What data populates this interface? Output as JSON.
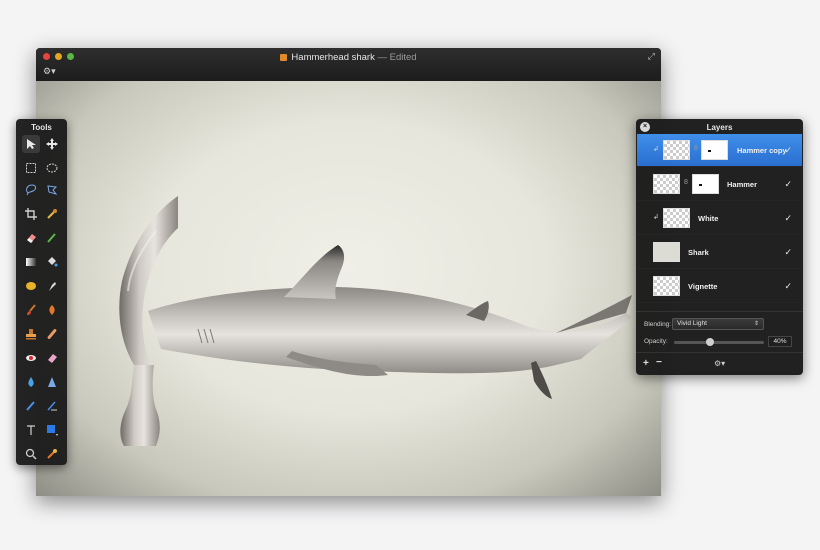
{
  "window": {
    "title": "Hammerhead shark",
    "status": "— Edited",
    "gear_glyph": "⚙▾",
    "fullscreen_glyph": "⤢"
  },
  "tools": {
    "title": "Tools",
    "items": [
      "arrow-select-icon",
      "move-icon",
      "rect-select-icon",
      "ellipse-select-icon",
      "lasso-icon",
      "polygon-lasso-icon",
      "crop-icon",
      "eyedropper-icon",
      "eraser-icon",
      "pencil-icon",
      "gradient-icon",
      "paint-bucket-icon",
      "sponge-icon",
      "smudge-icon",
      "brush-icon",
      "burn-icon",
      "clone-stamp-icon",
      "heal-icon",
      "red-eye-icon",
      "dodge-icon",
      "drop-icon",
      "sharpen-icon",
      "pen-icon",
      "path-icon",
      "text-icon",
      "shape-icon",
      "zoom-icon",
      "color-picker-icon"
    ]
  },
  "layers": {
    "title": "Layers",
    "close_glyph": "×",
    "items": [
      {
        "name": "Hammer copy",
        "visible": true,
        "selected": true
      },
      {
        "name": "Hammer",
        "visible": true,
        "selected": false
      },
      {
        "name": "White",
        "visible": true,
        "selected": false
      },
      {
        "name": "Shark",
        "visible": true,
        "selected": false
      },
      {
        "name": "Vignette",
        "visible": true,
        "selected": false
      }
    ],
    "check_glyph": "✓",
    "chain_glyph": "8",
    "clip_glyph": "↲",
    "blending_label": "Blending:",
    "blending_value": "Vivid Light",
    "blend_arrows": "⇕",
    "opacity_label": "Opacity:",
    "opacity_value": "40%",
    "opacity_fraction": 0.4,
    "add_glyph": "+",
    "remove_glyph": "−",
    "gear_glyph": "⚙▾"
  },
  "colors": {
    "selection": "#2f7be0",
    "active_swatch": "#2a6fd0"
  }
}
